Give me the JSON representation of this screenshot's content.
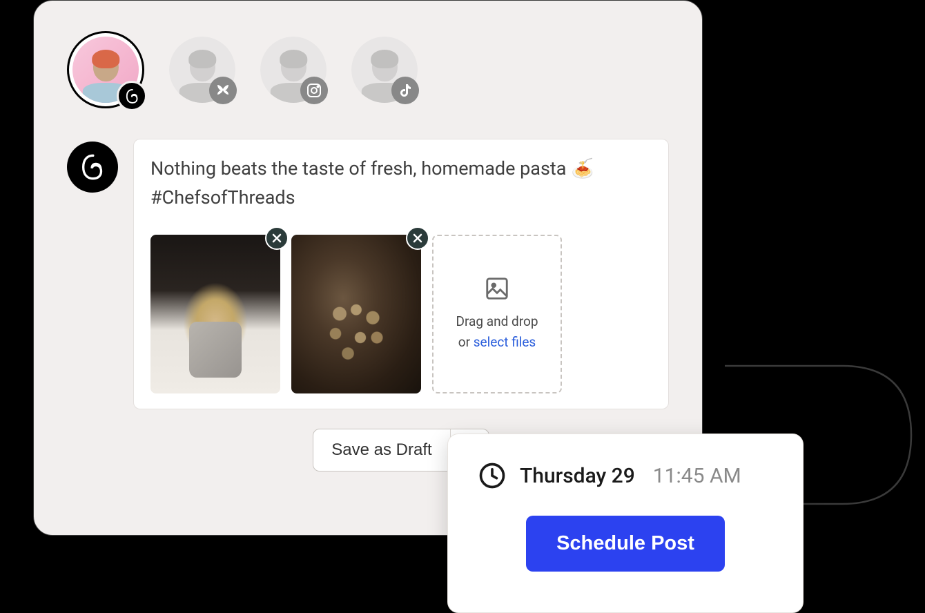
{
  "accounts": [
    {
      "platform": "threads",
      "selected": true
    },
    {
      "platform": "bluesky",
      "selected": false
    },
    {
      "platform": "instagram",
      "selected": false
    },
    {
      "platform": "tiktok",
      "selected": false
    }
  ],
  "compose": {
    "platform": "threads",
    "text": "Nothing beats the taste of fresh, homemade pasta 🍝 #ChefsofThreads",
    "media_count": 2,
    "dropzone": {
      "line1": "Drag and drop",
      "line2_prefix": "or ",
      "link": "select files"
    }
  },
  "actions": {
    "save_draft_label": "Save as Draft"
  },
  "schedule": {
    "date_label": "Thursday 29",
    "time_label": "11:45 AM",
    "button_label": "Schedule Post"
  }
}
